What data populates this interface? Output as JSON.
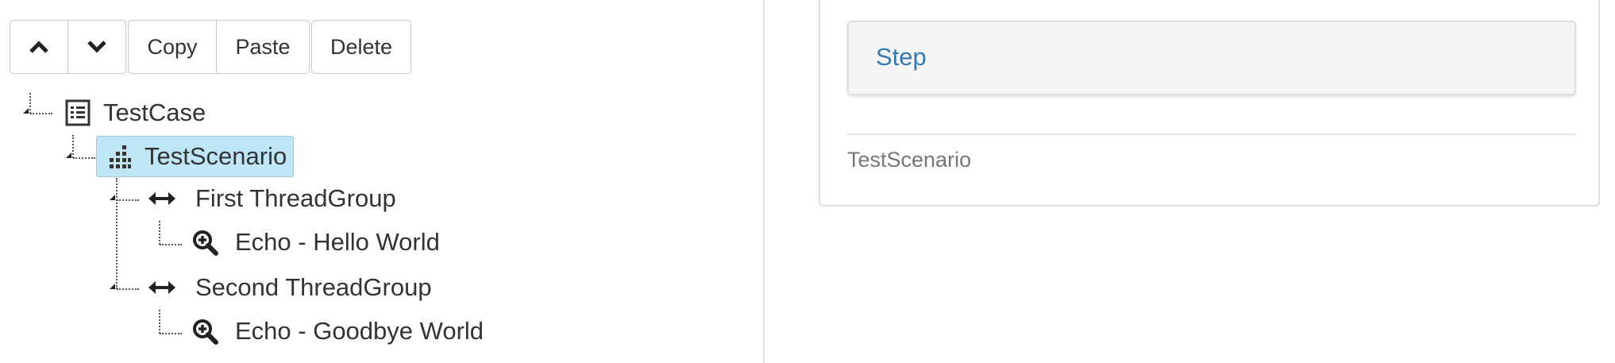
{
  "toolbar": {
    "move_up_icon": "chevron-up",
    "move_down_icon": "chevron-down",
    "copy_label": "Copy",
    "paste_label": "Paste",
    "delete_label": "Delete"
  },
  "tree": {
    "root": {
      "label": "TestCase",
      "icon": "list-alt"
    },
    "scenario": {
      "label": "TestScenario",
      "icon": "tasks",
      "selected": true
    },
    "groups": [
      {
        "label": "First ThreadGroup",
        "icon": "resize-horizontal",
        "children": [
          {
            "label": "Echo - Hello World",
            "icon": "zoom-in"
          }
        ]
      },
      {
        "label": "Second ThreadGroup",
        "icon": "resize-horizontal",
        "children": [
          {
            "label": "Echo - Goodbye World",
            "icon": "zoom-in"
          }
        ]
      }
    ]
  },
  "panel": {
    "heading_link": "Step",
    "body_text": "TestScenario",
    "accent_color": "#337ab7"
  },
  "colors": {
    "selection_bg": "#bfe6f7",
    "text": "#333333"
  }
}
